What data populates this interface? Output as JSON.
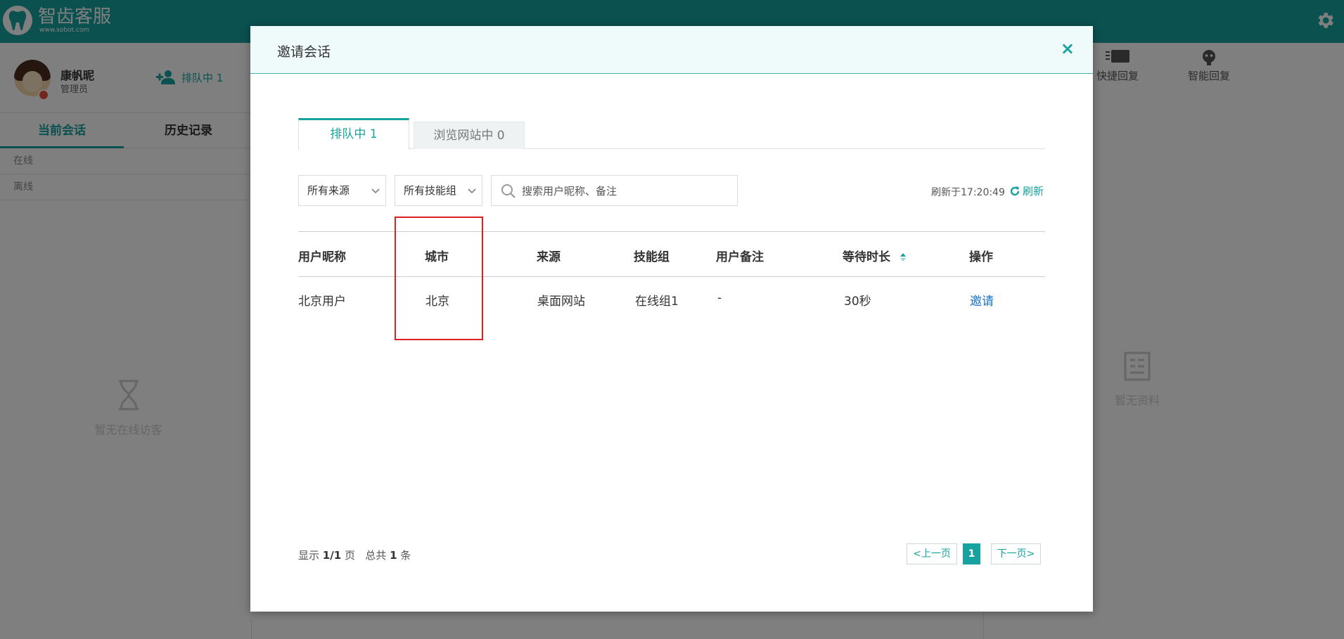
{
  "app": {
    "logo_name": "智齿客服",
    "logo_url": "www.sobot.com"
  },
  "profile": {
    "name": "康帆昵",
    "role": "管理员",
    "queue_label": "排队中 1"
  },
  "sidebar": {
    "tabs": [
      {
        "label": "当前会话",
        "active": true
      },
      {
        "label": "历史记录",
        "active": false
      }
    ],
    "groups": [
      "在线",
      "离线"
    ],
    "empty_text": "暂无在线访客"
  },
  "right_panel": {
    "quick_reply": "快捷回复",
    "smart_reply": "智能回复",
    "empty_text": "暂无资料"
  },
  "modal": {
    "title": "邀请会话",
    "close_symbol": "×",
    "tabs": [
      {
        "label": "排队中 1",
        "active": true
      },
      {
        "label": "浏览网站中 0",
        "active": false
      }
    ],
    "filters": {
      "source": "所有来源",
      "skill_group": "所有技能组",
      "search_placeholder": "搜索用户昵称、备注"
    },
    "refresh_time": "刷新于17:20:49",
    "refresh_label": "刷新",
    "table": {
      "headers": [
        "用户昵称",
        "城市",
        "来源",
        "技能组",
        "用户备注",
        "等待时长",
        "操作"
      ],
      "rows": [
        {
          "nickname": "北京用户",
          "city": "北京",
          "source": "桌面网站",
          "skill_group": "在线组1",
          "note": "-",
          "wait": "30秒",
          "action": "邀请"
        }
      ]
    },
    "footer": {
      "show_prefix": "显示",
      "page_value": "1/1",
      "page_unit": "页",
      "total_prefix": "总共",
      "total_value": "1",
      "total_unit": "条"
    },
    "pagination": {
      "prev": "<上一页",
      "current": "1",
      "next": "下一页>"
    }
  },
  "colors": {
    "accent": "#17a2a0",
    "link": "#1a73c9",
    "highlight": "#e02020"
  }
}
